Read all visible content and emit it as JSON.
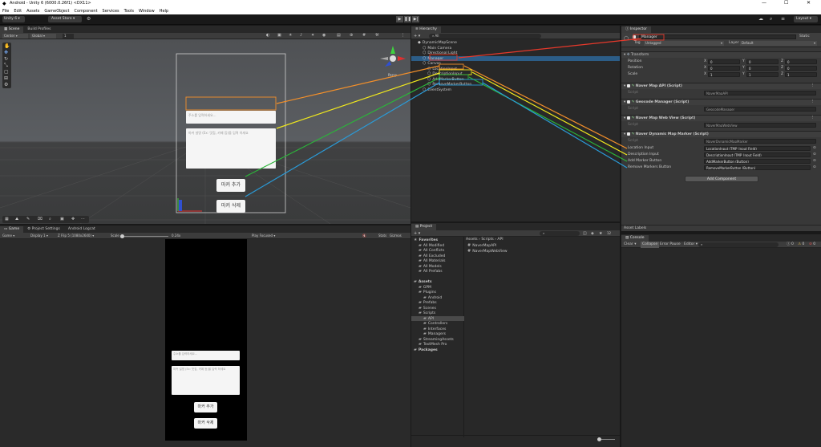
{
  "window": {
    "title": "Android - Unity 6 (6000.0.26f1) <DX11>"
  },
  "menu": [
    "File",
    "Edit",
    "Assets",
    "GameObject",
    "Component",
    "Services",
    "Tools",
    "Window",
    "Help"
  ],
  "toolbar": {
    "account": "Unity 6",
    "asset_store": "Asset Store",
    "layout": "Layout"
  },
  "scene": {
    "tabs": [
      "Scene",
      "Build Profiles"
    ],
    "pivot": "Center",
    "space": "Global",
    "snap": "1",
    "persp": "Persp",
    "canvas_ui": {
      "input1": "주소를 입력하세요...",
      "input2": "마커 설명 (Ex: 맛집, 카페 등)을 입력 하세요",
      "btn_add": "마커 추가",
      "btn_remove": "마커 삭제"
    }
  },
  "game": {
    "tabs": [
      "Game",
      "Project Settings",
      "Android Logcat"
    ],
    "mode": "Game",
    "display": "Display 1",
    "resolution": "Z Flip 5 (1080x2640)",
    "scale_label": "Scale",
    "scale_value": "0.24x",
    "play_focused": "Play Focused",
    "stats": "Stats",
    "gizmos": "Gizmos",
    "canvas_ui": {
      "input1": "주소를 입력하세요...",
      "input2": "마커 설명 (Ex: 맛집, 카페 등)을 입력 하세요",
      "btn_add": "마커 추가",
      "btn_remove": "마커 삭제"
    }
  },
  "hierarchy": {
    "tab": "Hierarchy",
    "search": "All",
    "items": [
      {
        "label": "DynamicMapScene",
        "indent": 0
      },
      {
        "label": "Main Camera",
        "indent": 1
      },
      {
        "label": "Directional Light",
        "indent": 1
      },
      {
        "label": "Manager",
        "indent": 1,
        "selected": true
      },
      {
        "label": "Canvas",
        "indent": 1
      },
      {
        "label": "LocationInput",
        "indent": 2
      },
      {
        "label": "DescriptionInput",
        "indent": 2
      },
      {
        "label": "AddMarkerButton",
        "indent": 2
      },
      {
        "label": "RemoveMarkerButton",
        "indent": 2
      },
      {
        "label": "EventSystem",
        "indent": 1
      }
    ]
  },
  "project": {
    "tab": "Project",
    "breadcrumb": [
      "Assets",
      "Scripts",
      "API"
    ],
    "tree": [
      {
        "label": "Favorites",
        "indent": 0,
        "bold": true
      },
      {
        "label": "All Modified",
        "indent": 1
      },
      {
        "label": "All Conflicts",
        "indent": 1
      },
      {
        "label": "All Excluded",
        "indent": 1
      },
      {
        "label": "All Materials",
        "indent": 1
      },
      {
        "label": "All Models",
        "indent": 1
      },
      {
        "label": "All Prefabs",
        "indent": 1
      },
      {
        "label": "",
        "indent": 0
      },
      {
        "label": "Assets",
        "indent": 0,
        "bold": true
      },
      {
        "label": "GPM",
        "indent": 1
      },
      {
        "label": "Plugins",
        "indent": 1
      },
      {
        "label": "Android",
        "indent": 2
      },
      {
        "label": "Prefabs",
        "indent": 1
      },
      {
        "label": "Scenes",
        "indent": 1
      },
      {
        "label": "Scripts",
        "indent": 1
      },
      {
        "label": "API",
        "indent": 2,
        "selected": true
      },
      {
        "label": "Controllers",
        "indent": 2
      },
      {
        "label": "Interfaces",
        "indent": 2
      },
      {
        "label": "Managers",
        "indent": 2
      },
      {
        "label": "StreamingAssets",
        "indent": 1
      },
      {
        "label": "TextMesh Pro",
        "indent": 1
      },
      {
        "label": "Packages",
        "indent": 0,
        "bold": true
      }
    ],
    "files": [
      "NaverMapAPI",
      "NaverMapWebView"
    ],
    "count": "12"
  },
  "inspector": {
    "tab": "Inspector",
    "name": "Manager",
    "static": "Static",
    "tag_label": "Tag",
    "tag": "Untagged",
    "layer_label": "Layer",
    "layer": "Default",
    "transform": {
      "title": "Transform",
      "position": [
        "0",
        "0",
        "0"
      ],
      "rotation": [
        "0",
        "0",
        "0"
      ],
      "scale": [
        "1",
        "1",
        "1"
      ],
      "labels": [
        "Position",
        "Rotation",
        "Scale"
      ]
    },
    "components": [
      {
        "title": "Naver Map API (Script)",
        "script": "NaverMapAPI"
      },
      {
        "title": "Geocode Manager (Script)",
        "script": "GeocodeManager"
      },
      {
        "title": "Naver Map Web View (Script)",
        "script": "NaverMapWebView"
      }
    ],
    "marker": {
      "title": "Naver Dynamic Map Marker (Script)",
      "script": "NaverDynamicMapMarker",
      "fields": [
        {
          "label": "Location Input",
          "value": "LocationInput (TMP_Input Field)"
        },
        {
          "label": "Description Input",
          "value": "DescriptionInput (TMP_Input Field)"
        },
        {
          "label": "Add Marker Button",
          "value": "AddMarkerButton (Button)"
        },
        {
          "label": "Remove Markers Button",
          "value": "RemoveMarkerButton (Button)"
        }
      ]
    },
    "add_component": "Add Component",
    "asset_labels": "Asset Labels",
    "script_label": "Script"
  },
  "console": {
    "tab": "Console",
    "clear": "Clear",
    "collapse": "Collapse",
    "error_pause": "Error Pause",
    "editor": "Editor",
    "counts": [
      "0",
      "0",
      "0"
    ]
  },
  "annotation_colors": [
    "#e8392b",
    "#f4902a",
    "#f0e81d",
    "#2bb53a",
    "#2a9bd8"
  ]
}
